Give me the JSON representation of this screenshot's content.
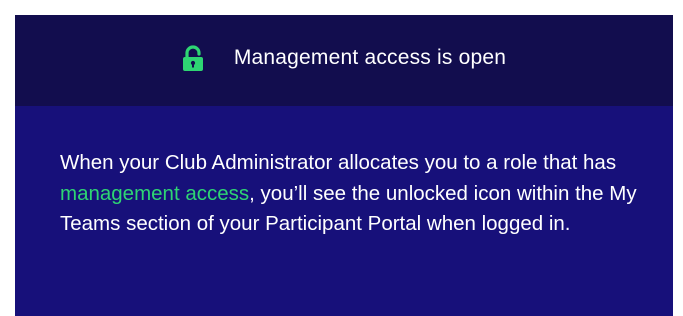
{
  "header": {
    "icon": "unlocked-padlock-icon",
    "title": "Management access is open"
  },
  "body": {
    "text_before": "When your Club Administrator allocates you to a role that has ",
    "highlight": "management access",
    "text_after": ", you’ll see the unlocked icon within the My Teams section of your Participant Portal when logged in."
  },
  "colors": {
    "card_background": "#17107a",
    "header_background": "#120d4e",
    "accent_green": "#2ed573",
    "text": "#ffffff"
  }
}
